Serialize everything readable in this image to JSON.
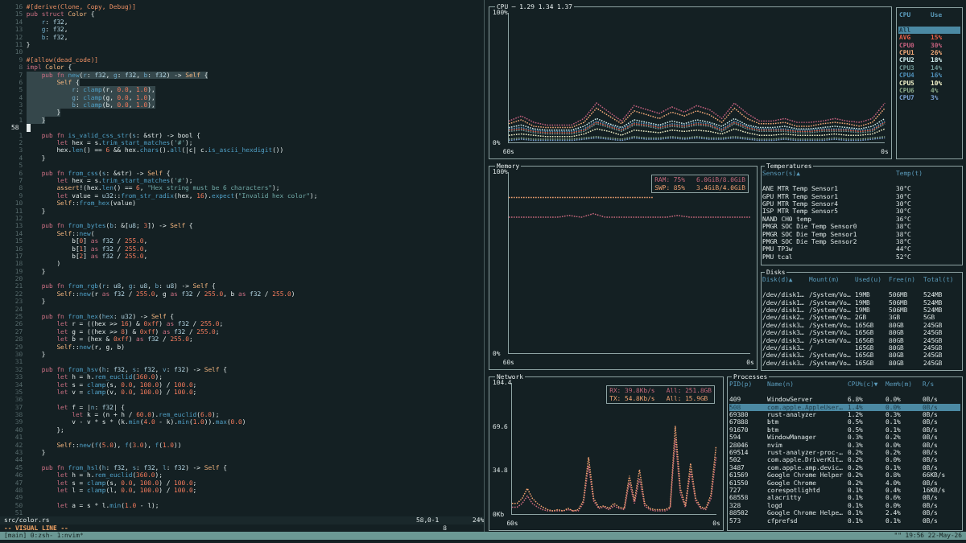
{
  "editor": {
    "lines": [
      {
        "n": "16",
        "text": "#[derive(Clone, Copy, Debug)]",
        "selected": false,
        "cursor": false
      },
      {
        "n": "15",
        "text": "pub struct Color {",
        "selected": false,
        "cursor": false
      },
      {
        "n": "14",
        "text": "    r: f32,",
        "selected": false,
        "cursor": false
      },
      {
        "n": "13",
        "text": "    g: f32,",
        "selected": false,
        "cursor": false
      },
      {
        "n": "12",
        "text": "    b: f32,",
        "selected": false,
        "cursor": false
      },
      {
        "n": "11",
        "text": "}",
        "selected": false,
        "cursor": false
      },
      {
        "n": "10",
        "selected": false,
        "cursor": false
      },
      {
        "n": "9",
        "text": "#[allow(dead_code)]",
        "selected": false,
        "cursor": false
      },
      {
        "n": "8",
        "text": "impl Color {",
        "selected": false,
        "cursor": false
      },
      {
        "n": "7",
        "text": "    pub fn new(r: f32, g: f32, b: f32) -> Self {",
        "selected": true,
        "cursor": false
      },
      {
        "n": "6",
        "text": "        Self {",
        "selected": true,
        "cursor": false
      },
      {
        "n": "5",
        "text": "            r: clamp(r, 0.0, 1.0),",
        "selected": true,
        "cursor": false
      },
      {
        "n": "4",
        "text": "            g: clamp(g, 0.0, 1.0),",
        "selected": true,
        "cursor": false
      },
      {
        "n": "3",
        "text": "            b: clamp(b, 0.0, 1.0),",
        "selected": true,
        "cursor": false
      },
      {
        "n": "2",
        "text": "        }",
        "selected": true,
        "cursor": false
      },
      {
        "n": "1",
        "text": "    }",
        "selected": true,
        "cursor": false
      },
      {
        "n": "58",
        "selected": true,
        "cursor": true
      },
      {
        "n": "1",
        "text": "    pub fn is_valid_css_str(s: &str) -> bool {",
        "selected": false,
        "cursor": false
      },
      {
        "n": "2",
        "text": "        let hex = s.trim_start_matches('#');",
        "selected": false,
        "cursor": false
      },
      {
        "n": "3",
        "text": "        hex.len() == 6 && hex.chars().all(|c| c.is_ascii_hexdigit())",
        "selected": false,
        "cursor": false
      },
      {
        "n": "4",
        "text": "    }",
        "selected": false,
        "cursor": false
      },
      {
        "n": "5",
        "selected": false,
        "cursor": false
      },
      {
        "n": "6",
        "text": "    pub fn from_css(s: &str) -> Self {",
        "selected": false,
        "cursor": false
      },
      {
        "n": "7",
        "text": "        let hex = s.trim_start_matches('#');",
        "selected": false,
        "cursor": false
      },
      {
        "n": "8",
        "text": "        assert!(hex.len() == 6, \"Hex string must be 6 characters\");",
        "selected": false,
        "cursor": false
      },
      {
        "n": "9",
        "text": "        let value = u32::from_str_radix(hex, 16).expect(\"Invalid hex color\");",
        "selected": false,
        "cursor": false
      },
      {
        "n": "10",
        "text": "        Self::from_hex(value)",
        "selected": false,
        "cursor": false
      },
      {
        "n": "11",
        "text": "    }",
        "selected": false,
        "cursor": false
      },
      {
        "n": "12",
        "selected": false,
        "cursor": false
      },
      {
        "n": "13",
        "text": "    pub fn from_bytes(b: &[u8; 3]) -> Self {",
        "selected": false,
        "cursor": false
      },
      {
        "n": "14",
        "text": "        Self::new(",
        "selected": false,
        "cursor": false
      },
      {
        "n": "15",
        "text": "            b[0] as f32 / 255.0,",
        "selected": false,
        "cursor": false
      },
      {
        "n": "16",
        "text": "            b[1] as f32 / 255.0,",
        "selected": false,
        "cursor": false
      },
      {
        "n": "17",
        "text": "            b[2] as f32 / 255.0,",
        "selected": false,
        "cursor": false
      },
      {
        "n": "18",
        "text": "        )",
        "selected": false,
        "cursor": false
      },
      {
        "n": "19",
        "text": "    }",
        "selected": false,
        "cursor": false
      },
      {
        "n": "20",
        "selected": false,
        "cursor": false
      },
      {
        "n": "21",
        "text": "    pub fn from_rgb(r: u8, g: u8, b: u8) -> Self {",
        "selected": false,
        "cursor": false
      },
      {
        "n": "22",
        "text": "        Self::new(r as f32 / 255.0, g as f32 / 255.0, b as f32 / 255.0)",
        "selected": false,
        "cursor": false
      },
      {
        "n": "23",
        "text": "    }",
        "selected": false,
        "cursor": false
      },
      {
        "n": "24",
        "selected": false,
        "cursor": false
      },
      {
        "n": "25",
        "text": "    pub fn from_hex(hex: u32) -> Self {",
        "selected": false,
        "cursor": false
      },
      {
        "n": "26",
        "text": "        let r = ((hex >> 16) & 0xff) as f32 / 255.0;",
        "selected": false,
        "cursor": false
      },
      {
        "n": "27",
        "text": "        let g = ((hex >> 8) & 0xff) as f32 / 255.0;",
        "selected": false,
        "cursor": false
      },
      {
        "n": "28",
        "text": "        let b = (hex & 0xff) as f32 / 255.0;",
        "selected": false,
        "cursor": false
      },
      {
        "n": "29",
        "text": "        Self::new(r, g, b)",
        "selected": false,
        "cursor": false
      },
      {
        "n": "30",
        "text": "    }",
        "selected": false,
        "cursor": false
      },
      {
        "n": "31",
        "selected": false,
        "cursor": false
      },
      {
        "n": "32",
        "text": "    pub fn from_hsv(h: f32, s: f32, v: f32) -> Self {",
        "selected": false,
        "cursor": false
      },
      {
        "n": "33",
        "text": "        let h = h.rem_euclid(360.0);",
        "selected": false,
        "cursor": false
      },
      {
        "n": "34",
        "text": "        let s = clamp(s, 0.0, 100.0) / 100.0;",
        "selected": false,
        "cursor": false
      },
      {
        "n": "35",
        "text": "        let v = clamp(v, 0.0, 100.0) / 100.0;",
        "selected": false,
        "cursor": false
      },
      {
        "n": "36",
        "selected": false,
        "cursor": false
      },
      {
        "n": "37",
        "text": "        let f = |n: f32| {",
        "selected": false,
        "cursor": false
      },
      {
        "n": "38",
        "text": "            let k = (n + h / 60.0).rem_euclid(6.0);",
        "selected": false,
        "cursor": false
      },
      {
        "n": "39",
        "text": "            v - v * s * (k.min(4.0 - k).min(1.0)).max(0.0)",
        "selected": false,
        "cursor": false
      },
      {
        "n": "40",
        "text": "        };",
        "selected": false,
        "cursor": false
      },
      {
        "n": "41",
        "selected": false,
        "cursor": false
      },
      {
        "n": "42",
        "text": "        Self::new(f(5.0), f(3.0), f(1.0))",
        "selected": false,
        "cursor": false
      },
      {
        "n": "43",
        "text": "    }",
        "selected": false,
        "cursor": false
      },
      {
        "n": "44",
        "selected": false,
        "cursor": false
      },
      {
        "n": "45",
        "text": "    pub fn from_hsl(h: f32, s: f32, l: f32) -> Self {",
        "selected": false,
        "cursor": false
      },
      {
        "n": "46",
        "text": "        let h = h.rem_euclid(360.0);",
        "selected": false,
        "cursor": false
      },
      {
        "n": "47",
        "text": "        let s = clamp(s, 0.0, 100.0) / 100.0;",
        "selected": false,
        "cursor": false
      },
      {
        "n": "48",
        "text": "        let l = clamp(l, 0.0, 100.0) / 100.0;",
        "selected": false,
        "cursor": false
      },
      {
        "n": "49",
        "selected": false,
        "cursor": false
      },
      {
        "n": "50",
        "text": "        let a = s * l.min(1.0 - l);",
        "selected": false,
        "cursor": false
      },
      {
        "n": "51",
        "selected": false,
        "cursor": false
      }
    ],
    "status": {
      "file": "src/color.rs",
      "position": "58,0-1",
      "scroll": "24%"
    },
    "mode": "-- VISUAL LINE --",
    "showcmd": "8"
  },
  "btm": {
    "cpu": {
      "title": "CPU ─ 1.29 1.34 1.37",
      "chart_data": {
        "type": "line",
        "x": [
          60,
          58,
          56,
          54,
          52,
          50,
          48,
          46,
          44,
          42,
          40,
          38,
          36,
          34,
          32,
          30,
          28,
          26,
          24,
          22,
          20,
          18,
          16,
          14,
          12,
          10,
          8,
          6,
          4,
          2,
          0
        ],
        "xlim": [
          60,
          0
        ],
        "ylim": [
          0,
          100
        ],
        "xticks": [
          {
            "value": 60,
            "label": "60s"
          },
          {
            "value": 0,
            "label": "0s"
          }
        ],
        "yticks": [
          {
            "value": 0,
            "label": "0%"
          },
          {
            "value": 100,
            "label": "100%"
          }
        ],
        "series": [
          {
            "color": "#e8604a",
            "line_style": "dotted",
            "values": [
              9,
              10,
              8,
              7,
              7,
              7,
              9,
              15,
              12,
              9,
              14,
              13,
              11,
              13,
              12,
              14,
              13,
              9,
              15,
              11,
              9,
              9,
              9,
              8,
              8,
              9,
              9,
              9,
              8,
              9,
              15
            ]
          },
          {
            "color": "#c4607e",
            "line_style": "dotted",
            "values": [
              16,
              20,
              15,
              13,
              13,
              13,
              18,
              30,
              23,
              16,
              28,
              25,
              22,
              27,
              23,
              28,
              25,
              18,
              30,
              22,
              16,
              16,
              18,
              15,
              15,
              16,
              18,
              16,
              15,
              18,
              30
            ]
          },
          {
            "color": "#f0a878",
            "line_style": "dotted",
            "values": [
              14,
              17,
              12,
              11,
              11,
              11,
              15,
              26,
              20,
              14,
              24,
              21,
              18,
              23,
              20,
              24,
              21,
              15,
              26,
              18,
              14,
              14,
              15,
              12,
              12,
              14,
              15,
              14,
              12,
              15,
              26
            ]
          },
          {
            "color": "#d0ecec",
            "line_style": "dotted",
            "values": [
              11,
              13,
              10,
              9,
              9,
              9,
              12,
              18,
              14,
              11,
              17,
              15,
              13,
              16,
              14,
              17,
              15,
              12,
              18,
              13,
              11,
              11,
              12,
              10,
              10,
              11,
              12,
              11,
              10,
              12,
              18
            ]
          },
          {
            "color": "#6c9494",
            "line_style": "dotted",
            "values": [
              8,
              9,
              7,
              6,
              6,
              6,
              8,
              14,
              11,
              8,
              13,
              12,
              10,
              12,
              11,
              13,
              12,
              8,
              14,
              10,
              8,
              8,
              8,
              7,
              7,
              8,
              8,
              8,
              7,
              8,
              14
            ]
          },
          {
            "color": "#4f8fb8",
            "line_style": "dotted",
            "values": [
              10,
              11,
              9,
              8,
              8,
              8,
              10,
              16,
              13,
              10,
              15,
              14,
              12,
              14,
              13,
              15,
              14,
              10,
              16,
              12,
              10,
              10,
              10,
              9,
              9,
              10,
              10,
              10,
              9,
              10,
              16
            ]
          },
          {
            "color": "#f0f0c8",
            "line_style": "dotted",
            "values": [
              5,
              6,
              5,
              4,
              4,
              4,
              6,
              10,
              8,
              5,
              9,
              8,
              7,
              9,
              8,
              9,
              8,
              6,
              10,
              7,
              5,
              5,
              6,
              5,
              5,
              5,
              6,
              5,
              5,
              6,
              10
            ]
          },
          {
            "color": "#8aa888",
            "line_style": "dotted",
            "values": [
              2,
              3,
              2,
              2,
              2,
              2,
              3,
              4,
              3,
              2,
              4,
              3,
              3,
              4,
              3,
              4,
              3,
              3,
              4,
              3,
              2,
              2,
              3,
              2,
              2,
              2,
              3,
              2,
              2,
              3,
              4
            ]
          },
          {
            "color": "#7aa0d0",
            "line_style": "dotted",
            "values": [
              1,
              2,
              1,
              1,
              1,
              1,
              2,
              3,
              2,
              1,
              3,
              2,
              2,
              3,
              2,
              3,
              2,
              2,
              3,
              2,
              1,
              1,
              2,
              1,
              1,
              1,
              2,
              1,
              1,
              2,
              3
            ]
          }
        ]
      }
    },
    "cpu_legend": {
      "columns": [
        "CPU",
        "Use"
      ],
      "rows": [
        {
          "name": "All",
          "selected": true
        },
        {
          "name": "AVG",
          "use": "15%",
          "color": "#e8604a",
          "selected": false
        },
        {
          "name": "CPU0",
          "use": "30%",
          "color": "#c4607e",
          "selected": false
        },
        {
          "name": "CPU1",
          "use": "26%",
          "color": "#f0a878",
          "selected": false
        },
        {
          "name": "CPU2",
          "use": "18%",
          "color": "#d0ecec",
          "selected": false
        },
        {
          "name": "CPU3",
          "use": "14%",
          "color": "#6c9494",
          "selected": false
        },
        {
          "name": "CPU4",
          "use": "16%",
          "color": "#4f8fb8",
          "selected": false
        },
        {
          "name": "CPU5",
          "use": "10%",
          "color": "#f0f0c8",
          "selected": false
        },
        {
          "name": "CPU6",
          "use": "4%",
          "color": "#8aa888",
          "selected": false
        },
        {
          "name": "CPU7",
          "use": "3%",
          "color": "#7aa0d0",
          "selected": false
        }
      ]
    },
    "memory": {
      "title": "Memory",
      "legend": [
        {
          "label": "RAM: 75%",
          "value": "6.0GiB/8.0GiB"
        },
        {
          "label": "SWP: 85%",
          "value": "3.4GiB/4.0GiB"
        }
      ],
      "chart_data": {
        "type": "line",
        "x": [
          60,
          57,
          54,
          51,
          48,
          45,
          42,
          39,
          36,
          33,
          30,
          27,
          24,
          21,
          18,
          15,
          12,
          9,
          6,
          3,
          0
        ],
        "xlim": [
          60,
          0
        ],
        "ylim": [
          0,
          100
        ],
        "xticks": [
          {
            "value": 60,
            "label": "60s"
          },
          {
            "value": 0,
            "label": "0s"
          }
        ],
        "yticks": [
          {
            "value": 0,
            "label": "0%"
          },
          {
            "value": 100,
            "label": "100%"
          }
        ],
        "series": [
          {
            "color": "#c8687c",
            "line_style": "dotted",
            "values": [
              75,
              75,
              75,
              75,
              75,
              76,
              75,
              77,
              75,
              75,
              75,
              75,
              75,
              75,
              76,
              75,
              75,
              75,
              75,
              75,
              75
            ]
          },
          {
            "color": "#f0a070",
            "line_style": "dotted",
            "values": [
              86,
              86,
              86,
              86,
              86,
              86,
              86,
              86,
              86,
              86,
              86,
              86,
              86,
              null,
              null,
              null,
              null,
              null,
              null,
              null,
              null
            ]
          }
        ]
      }
    },
    "temperatures": {
      "title": "Temperatures",
      "columns": [
        "Sensor(s)▲",
        "Temp(t)"
      ],
      "rows": [
        [
          "ANE MTR Temp Sensor1",
          "30°C"
        ],
        [
          "GPU MTR Temp Sensor1",
          "30°C"
        ],
        [
          "GPU MTR Temp Sensor4",
          "30°C"
        ],
        [
          "ISP MTR Temp Sensor5",
          "30°C"
        ],
        [
          "NAND CH0 temp",
          "36°C"
        ],
        [
          "PMGR SOC Die Temp Sensor0",
          "38°C"
        ],
        [
          "PMGR SOC Die Temp Sensor1",
          "38°C"
        ],
        [
          "PMGR SOC Die Temp Sensor2",
          "38°C"
        ],
        [
          "PMU TP3w",
          "44°C"
        ],
        [
          "PMU tcal",
          "52°C"
        ]
      ]
    },
    "disks": {
      "title": "Disks",
      "columns": [
        "Disk(d)▲",
        "Mount(m)",
        "Used(u)",
        "Free(n)",
        "Total(t)"
      ],
      "rows": [
        [
          "/dev/disk1…",
          "/System/Vo…",
          "19MB",
          "506MB",
          "524MB"
        ],
        [
          "/dev/disk1…",
          "/System/Vo…",
          "19MB",
          "506MB",
          "524MB"
        ],
        [
          "/dev/disk1…",
          "/System/Vo…",
          "19MB",
          "506MB",
          "524MB"
        ],
        [
          "/dev/disk2…",
          "/System/Vo…",
          "2GB",
          "3GB",
          "5GB"
        ],
        [
          "/dev/disk3…",
          "/System/Vo…",
          "165GB",
          "80GB",
          "245GB"
        ],
        [
          "/dev/disk3…",
          "/System/Vo…",
          "165GB",
          "80GB",
          "245GB"
        ],
        [
          "/dev/disk3…",
          "/System/Vo…",
          "165GB",
          "80GB",
          "245GB"
        ],
        [
          "/dev/disk3…",
          "/",
          "165GB",
          "80GB",
          "245GB"
        ],
        [
          "/dev/disk3…",
          "/System/Vo…",
          "165GB",
          "80GB",
          "245GB"
        ],
        [
          "/dev/disk3…",
          "/System/Vo…",
          "165GB",
          "80GB",
          "245GB"
        ]
      ]
    },
    "network": {
      "title": "Network",
      "legend": [
        {
          "label": "RX: 39.8Kb/s",
          "value": "All: 251.8GB"
        },
        {
          "label": "TX: 54.8Kb/s",
          "value": "All: 15.9GB"
        }
      ],
      "chart_data": {
        "type": "line",
        "x": [
          60,
          58.5,
          57,
          55.5,
          54,
          52.5,
          51,
          49.5,
          48,
          46.5,
          45,
          43.5,
          42,
          40.5,
          39,
          37.5,
          36,
          34.5,
          33,
          31.5,
          30,
          28.5,
          27,
          25.5,
          24,
          22.5,
          21,
          19.5,
          18,
          16.5,
          15,
          13.5,
          12,
          10.5,
          9,
          7.5,
          6,
          4.5,
          3,
          1.5,
          0
        ],
        "xlim": [
          60,
          0
        ],
        "ylim": [
          0,
          104.4
        ],
        "xticks": [
          {
            "value": 60,
            "label": "60s"
          },
          {
            "value": 0,
            "label": "0s"
          }
        ],
        "yticks": [
          {
            "value": 0,
            "label": "0Kb"
          },
          {
            "value": 34.8,
            "label": "34.8"
          },
          {
            "value": 69.6,
            "label": "69.6"
          },
          {
            "value": 104.4,
            "label": "104.4"
          }
        ],
        "series": [
          {
            "color": "#c8687c",
            "line_style": "dotted",
            "values": [
              5,
              5,
              8,
              14,
              8,
              5,
              3,
              2,
              2,
              2,
              2,
              3,
              2,
              2,
              8,
              38,
              10,
              4,
              5,
              3,
              6,
              4,
              3,
              25,
              8,
              28,
              6,
              3,
              2,
              2,
              2,
              4,
              60,
              16,
              5,
              34,
              10,
              4,
              3,
              12,
              45
            ]
          },
          {
            "color": "#f0a070",
            "line_style": "dotted",
            "values": [
              8,
              8,
              12,
              20,
              12,
              8,
              5,
              3,
              2,
              3,
              2,
              4,
              2,
              3,
              10,
              45,
              12,
              5,
              6,
              4,
              8,
              5,
              4,
              30,
              10,
              35,
              8,
              4,
              3,
              3,
              3,
              5,
              70,
              20,
              6,
              40,
              12,
              5,
              4,
              15,
              54
            ]
          }
        ]
      }
    },
    "processes": {
      "title": "Processes",
      "columns": [
        "PID(p)",
        "Name(n)",
        "CPU%(c)▼",
        "Mem%(m)",
        "R/s"
      ],
      "rows": [
        {
          "cells": [
            "409",
            "WindowServer",
            "6.8%",
            "0.0%",
            "0B/s"
          ],
          "selected": false
        },
        {
          "cells": [
            "508",
            "com.apple.AppleUser…",
            "1.4%",
            "0.0%",
            "0B/s"
          ],
          "selected": true
        },
        {
          "cells": [
            "69380",
            "rust-analyzer",
            "1.2%",
            "0.3%",
            "0B/s"
          ],
          "selected": false
        },
        {
          "cells": [
            "67888",
            "btm",
            "0.5%",
            "0.1%",
            "0B/s"
          ],
          "selected": false
        },
        {
          "cells": [
            "91670",
            "btm",
            "0.5%",
            "0.1%",
            "0B/s"
          ],
          "selected": false
        },
        {
          "cells": [
            "594",
            "WindowManager",
            "0.3%",
            "0.2%",
            "0B/s"
          ],
          "selected": false
        },
        {
          "cells": [
            "28046",
            "nvim",
            "0.3%",
            "0.0%",
            "0B/s"
          ],
          "selected": false
        },
        {
          "cells": [
            "69514",
            "rust-analyzer-proc-…",
            "0.2%",
            "0.2%",
            "0B/s"
          ],
          "selected": false
        },
        {
          "cells": [
            "502",
            "com.apple.DriverKit…",
            "0.2%",
            "0.0%",
            "0B/s"
          ],
          "selected": false
        },
        {
          "cells": [
            "3487",
            "com.apple.amp.devic…",
            "0.2%",
            "0.1%",
            "0B/s"
          ],
          "selected": false
        },
        {
          "cells": [
            "61569",
            "Google Chrome Helper",
            "0.2%",
            "0.8%",
            "66KB/s"
          ],
          "selected": false
        },
        {
          "cells": [
            "61550",
            "Google Chrome",
            "0.2%",
            "4.0%",
            "0B/s"
          ],
          "selected": false
        },
        {
          "cells": [
            "727",
            "corespotlightd",
            "0.1%",
            "0.4%",
            "16KB/s"
          ],
          "selected": false
        },
        {
          "cells": [
            "68558",
            "alacritty",
            "0.1%",
            "0.6%",
            "0B/s"
          ],
          "selected": false
        },
        {
          "cells": [
            "328",
            "logd",
            "0.1%",
            "0.0%",
            "0B/s"
          ],
          "selected": false
        },
        {
          "cells": [
            "88502",
            "Google Chrome Helpe…",
            "0.1%",
            "2.4%",
            "0B/s"
          ],
          "selected": false
        },
        {
          "cells": [
            "573",
            "cfprefsd",
            "0.1%",
            "0.1%",
            "0B/s"
          ],
          "selected": false
        }
      ]
    }
  },
  "tmux": {
    "session": "[main]",
    "windows": [
      "0:zsh-",
      "1:nvim*"
    ],
    "status_right": "\"\" 19:56 22-May-26"
  }
}
